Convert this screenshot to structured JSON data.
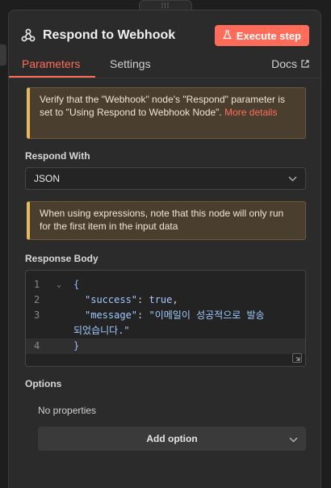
{
  "header": {
    "title": "Respond to Webhook",
    "execute_label": "Execute step"
  },
  "tabs": [
    {
      "label": "Parameters",
      "active": true
    },
    {
      "label": "Settings",
      "active": false
    }
  ],
  "docs_label": "Docs",
  "notice_webhook": {
    "text": "Verify that the \"Webhook\" node's \"Respond\" parameter is set to \"Using Respond to Webhook Node\".",
    "link": "More details"
  },
  "respond_with": {
    "label": "Respond With",
    "value": "JSON"
  },
  "notice_expressions": {
    "text": "When using expressions, note that this node will only run for the first item in the input data"
  },
  "response_body": {
    "label": "Response Body",
    "lines": [
      {
        "num": "1",
        "text": "{"
      },
      {
        "num": "2",
        "key": "\"success\"",
        "value": "true"
      },
      {
        "num": "3",
        "key": "\"message\"",
        "value_line1": "\"이메일이 성공적으로 발송",
        "value_line2": "되었습니다.\""
      },
      {
        "num": "4",
        "text": "}"
      }
    ]
  },
  "options": {
    "label": "Options",
    "empty_text": "No properties",
    "add_label": "Add option"
  },
  "colors": {
    "accent": "#ff6d5a",
    "notice_border": "#e8b85e",
    "panel_bg": "#2b2b2b"
  }
}
